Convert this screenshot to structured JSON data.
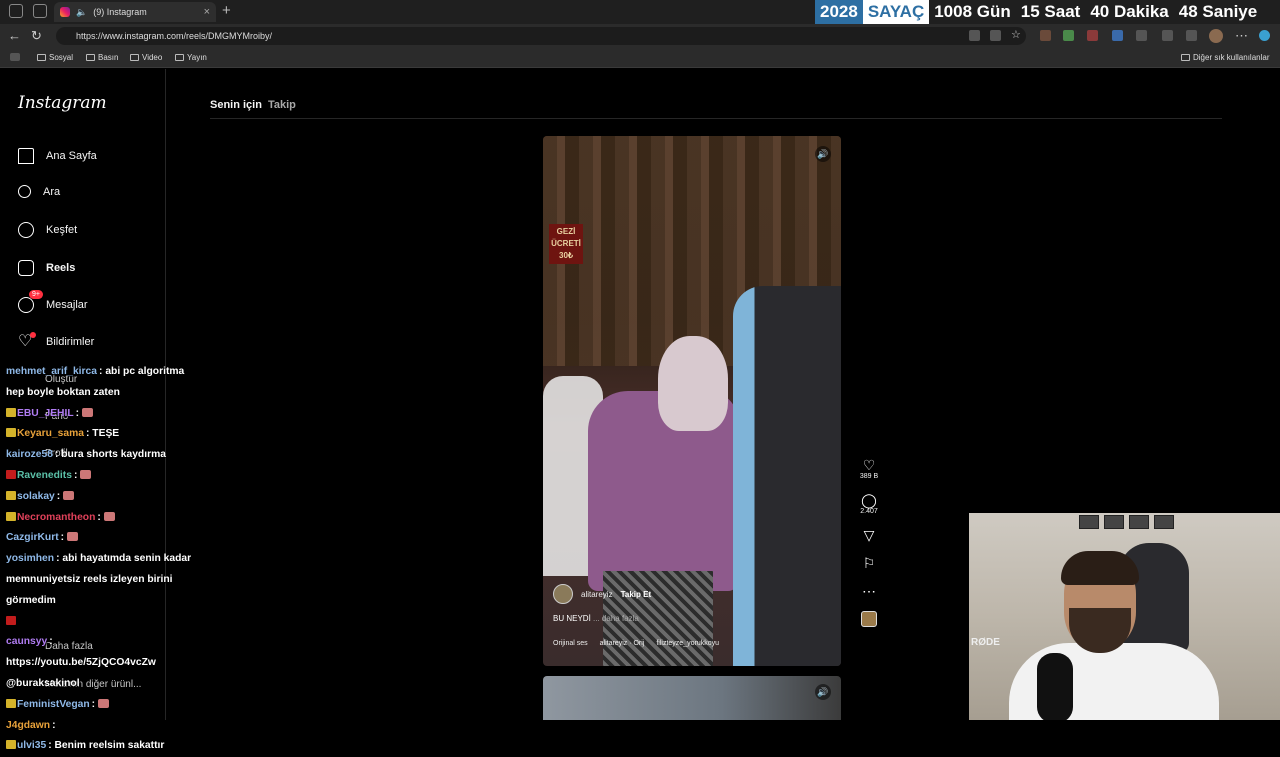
{
  "browser": {
    "tab_title": "(9) Instagram",
    "tab_close": "×",
    "new_tab": "+",
    "url": "https://www.instagram.com/reels/DMGMYMroiby/",
    "bookmarks": [
      "Sosyal",
      "Basın",
      "Video",
      "Yayın"
    ],
    "other_bookmarks": "Diğer sık kullanılanlar"
  },
  "counter": {
    "year": "2028",
    "label": "SAYAÇ",
    "days": "1008 Gün",
    "hours": "15 Saat",
    "minutes": "40 Dakika",
    "seconds": "48 Saniye"
  },
  "instagram": {
    "logo": "Instagram",
    "nav": [
      {
        "label": "Ana Sayfa"
      },
      {
        "label": "Ara"
      },
      {
        "label": "Keşfet"
      },
      {
        "label": "Reels"
      },
      {
        "label": "Mesajlar",
        "badge": "9+"
      },
      {
        "label": "Bildirimler"
      },
      {
        "label": "Oluştur"
      },
      {
        "label": "Pano"
      },
      {
        "label": "Profil"
      },
      {
        "label": "Daha fazla"
      },
      {
        "label": "Meta'nın diğer ürünl..."
      }
    ],
    "feed_tabs": [
      "Senin için",
      "Takip"
    ],
    "reel": {
      "author": "alitareyiz",
      "follow": "Takip Et",
      "caption": "BU NEYDİ",
      "caption_more": "... daha fazla",
      "audio": [
        "Orijinal ses",
        "alitareyiz · Orij",
        "filizteyze_yorukkoyu"
      ],
      "sign_text": "GEZİ ÜCRETİ 30₺"
    },
    "actions": {
      "likes": "389 B",
      "comments": "2.407"
    }
  },
  "chat": [
    {
      "user": "mehmet_arif_kirca",
      "msg": "abi pc algoritma hep boyle boktan zaten",
      "color": "#8fb9e8",
      "badge": ""
    },
    {
      "user": "EBU_JEHIL",
      "msg": "",
      "color": "#b07cf2",
      "badge": "yellow",
      "emoji": true
    },
    {
      "user": "Keyaru_sama",
      "msg": "TEŞE",
      "color": "#e8a23a",
      "badge": "yellow"
    },
    {
      "user": "kairoze58",
      "msg": "bura shorts kaydırma",
      "color": "#8fb9e8",
      "badge": ""
    },
    {
      "user": "Ravenedits",
      "msg": "",
      "color": "#5bc0a8",
      "badge": "red",
      "emoji": true
    },
    {
      "user": "solakay",
      "msg": "",
      "color": "#8fb9e8",
      "badge": "emote",
      "emoji": true
    },
    {
      "user": "Necromantheon",
      "msg": "",
      "color": "#e0415a",
      "badge": "yellow",
      "emoji": true
    },
    {
      "user": "CazgirKurt",
      "msg": "",
      "color": "#8fb9e8",
      "badge": "",
      "emoji": true
    },
    {
      "user": "yosimhen",
      "msg": "abi hayatımda senin kadar memnuniyetsiz reels izleyen birini görmedim",
      "color": "#8fb9e8",
      "badge": ""
    },
    {
      "user": "",
      "msg": "",
      "color": "#ffffff",
      "badge": "red"
    },
    {
      "user": "caunsyy",
      "msg": "https://youtu.be/5ZjQCO4vcZw @buraksakinol",
      "color": "#b07cf2",
      "badge": ""
    },
    {
      "user": "FeministVegan",
      "msg": "",
      "color": "#8fb9e8",
      "badge": "yellow",
      "emoji": true
    },
    {
      "user": "J4gdawn",
      "msg": "",
      "color": "#e8a23a",
      "badge": ""
    },
    {
      "user": "ulvi35",
      "msg": "Benim reelsim sakattır",
      "color": "#8fb9e8",
      "badge": "yellow"
    }
  ],
  "webcam": {
    "mic_brand": "RØDE"
  }
}
